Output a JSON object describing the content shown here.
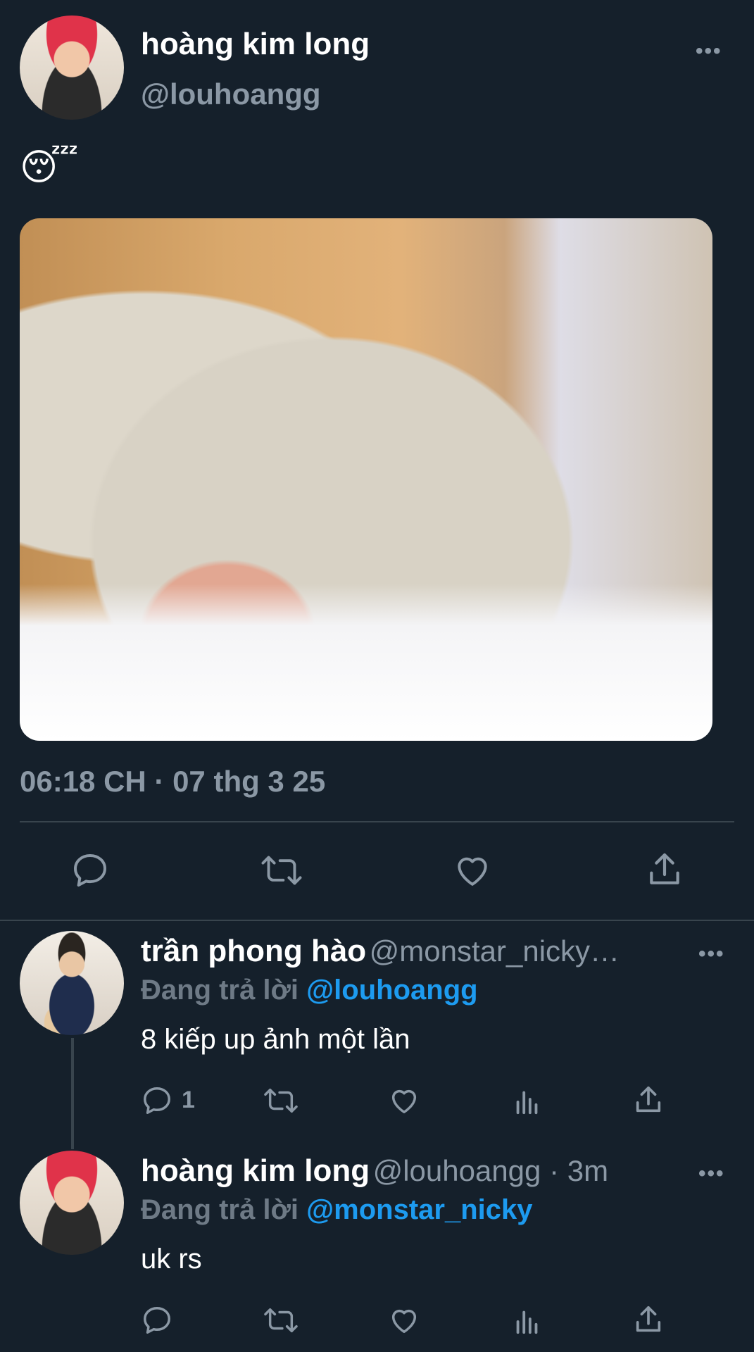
{
  "main_tweet": {
    "author_name": "hoàng kim long",
    "author_handle": "@louhoangg",
    "emoji": "😴",
    "timestamp": "06:18 CH · 07 thg 3 25",
    "more": "•••"
  },
  "replies": [
    {
      "author_name": "trần phong hào",
      "author_handle": "@monstar_nicky…",
      "replying_label": "Đang trả lời",
      "replying_to": "@louhoangg",
      "text": "8 kiếp up ảnh một lần",
      "reply_count": "1",
      "more": "•••"
    },
    {
      "author_name": "hoàng kim long",
      "author_handle": "@louhoangg · 3m",
      "replying_label": "Đang trả lời",
      "replying_to": "@monstar_nicky",
      "text": "uk rs",
      "more": "•••"
    }
  ],
  "icons": {
    "reply": "reply-icon",
    "retweet": "retweet-icon",
    "like": "heart-icon",
    "share": "share-icon",
    "analytics": "analytics-icon"
  },
  "colors": {
    "background": "#15202b",
    "accent": "#1d9bf0",
    "muted": "#8b98a5"
  }
}
